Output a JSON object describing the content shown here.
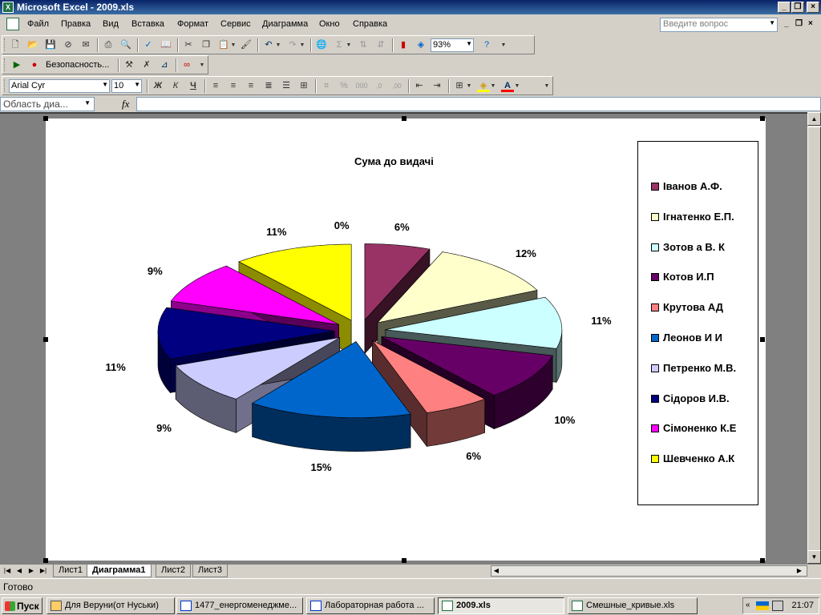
{
  "window": {
    "title": "Microsoft Excel - 2009.xls"
  },
  "menubar": {
    "items": [
      "Файл",
      "Правка",
      "Вид",
      "Вставка",
      "Формат",
      "Сервис",
      "Диаграмма",
      "Окно",
      "Справка"
    ],
    "ask_placeholder": "Введите вопрос"
  },
  "toolbar_standard": {
    "zoom": "93%"
  },
  "toolbar_security": {
    "security_label": "Безопасность..."
  },
  "toolbar_formatting": {
    "font": "Arial Cyr",
    "size": "10",
    "bold": "Ж",
    "italic": "К",
    "underline": "Ч"
  },
  "formula_bar": {
    "name_box": "Область диа...",
    "fx": "fx"
  },
  "chart": {
    "title": "Сума до видачі"
  },
  "chart_data": {
    "type": "pie",
    "title": "Сума до видачі",
    "legend_position": "right",
    "series": [
      {
        "name": "",
        "labels": [
          "Іванов А.Ф.",
          "Ігнатенко Е.П.",
          "Зотов а В. К",
          "Котов И.П",
          "Крутова АД",
          "Леонов И И",
          "Петренко М.В.",
          "Сідоров И.В.",
          "Сімоненко К.Е",
          "Шевченко А.К"
        ],
        "values": [
          6,
          12,
          11,
          10,
          6,
          15,
          9,
          11,
          9,
          11
        ],
        "data_labels": [
          "6%",
          "12%",
          "11%",
          "10%",
          "6%",
          "15%",
          "9%",
          "11%",
          "9%",
          "11%"
        ],
        "colors": [
          "#993366",
          "#ffffcc",
          "#ccffff",
          "#660066",
          "#ff8080",
          "#0066cc",
          "#ccccff",
          "#000080",
          "#ff00ff",
          "#ffff00"
        ]
      }
    ],
    "extra_labels": [
      "0%"
    ]
  },
  "sheets": {
    "tabs": [
      "Лист1",
      "Диаграмма1",
      "Лист2",
      "Лист3"
    ],
    "active": "Диаграмма1"
  },
  "status": {
    "text": "Готово"
  },
  "taskbar": {
    "start": "Пуск",
    "tasks": [
      "Для Веруни(от Нуськи)",
      "1477_енергоменеджме...",
      "Лабораторная работа ...",
      "2009.xls",
      "Смешные_кривые.xls"
    ],
    "active_task": "2009.xls",
    "clock": "21:07"
  }
}
